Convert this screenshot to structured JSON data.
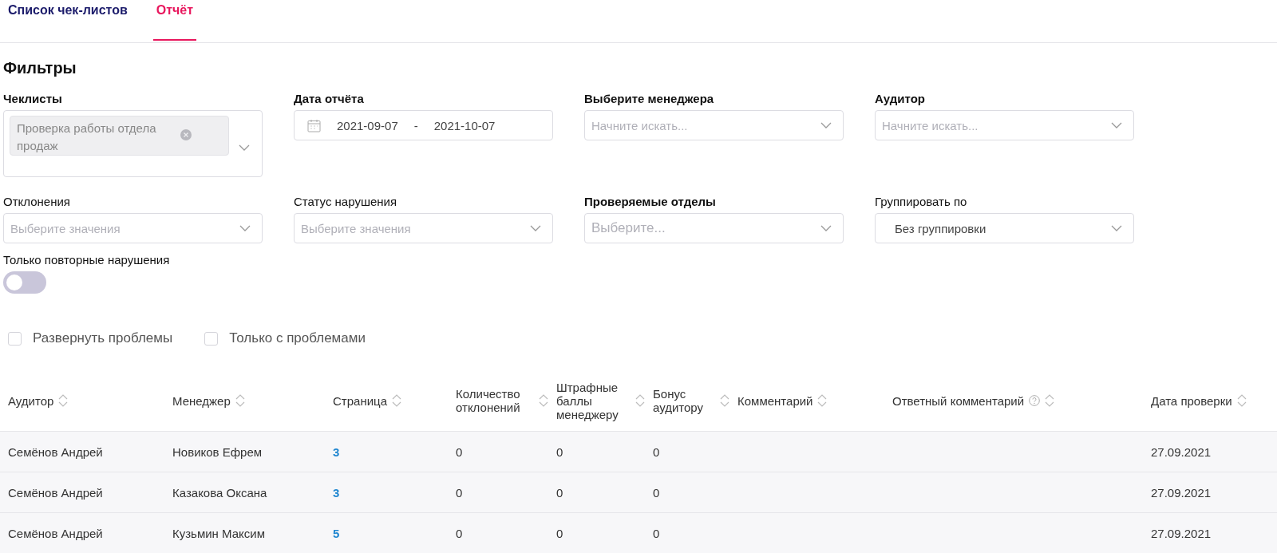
{
  "tabs": [
    {
      "label": "Список чек-листов",
      "selected": false
    },
    {
      "label": "Отчёт",
      "selected": true
    }
  ],
  "filters": {
    "title": "Фильтры",
    "fields": [
      {
        "kind": "tags",
        "label": "Чеклисты",
        "bold": true,
        "tags": [
          "Проверка работы отдела продаж"
        ]
      },
      {
        "kind": "daterange",
        "label": "Дата отчёта",
        "bold": true,
        "from": "2021-09-07",
        "separator": "-",
        "to": "2021-10-07"
      },
      {
        "kind": "select",
        "label": "Выберите менеджера",
        "bold": true,
        "placeholder": "Начните искать..."
      },
      {
        "kind": "select",
        "label": "Аудитор",
        "bold": true,
        "placeholder": "Начните искать..."
      },
      {
        "kind": "select",
        "label": "Отклонения",
        "bold": false,
        "placeholder": "Выберите значения"
      },
      {
        "kind": "select",
        "label": "Статус нарушения",
        "bold": false,
        "placeholder": "Выберите значения"
      },
      {
        "kind": "select",
        "label": "Проверяемые отделы",
        "bold": true,
        "placeholder": "Выберите..."
      },
      {
        "kind": "select",
        "label": "Группировать по",
        "bold": false,
        "value": "Без группировки"
      }
    ],
    "toggle": {
      "label": "Только повторные нарушения",
      "on": false
    }
  },
  "options": [
    {
      "label": "Развернуть проблемы",
      "checked": false
    },
    {
      "label": "Только с проблемами",
      "checked": false
    }
  ],
  "table": {
    "columns": [
      {
        "label": "Аудитор",
        "help": false,
        "link": false
      },
      {
        "label": "Менеджер",
        "help": false,
        "link": false
      },
      {
        "label": "Страница",
        "help": false,
        "link": true
      },
      {
        "label": "Количество отклонений",
        "help": false,
        "link": false
      },
      {
        "label": "Штрафные баллы менеджеру",
        "help": false,
        "link": false
      },
      {
        "label": "Бонус аудитору",
        "help": false,
        "link": false
      },
      {
        "label": "Комментарий",
        "help": false
      },
      {
        "label": "Ответный комментарий",
        "help": true
      },
      {
        "label": "Дата проверки",
        "help": false,
        "link": false
      }
    ],
    "rows": [
      [
        "Семёнов Андрей",
        "Новиков Ефрем",
        "3",
        "0",
        "0",
        "0",
        null,
        null,
        "27.09.2021"
      ],
      [
        "Семёнов Андрей",
        "Казакова Оксана",
        "3",
        "0",
        "0",
        "0",
        null,
        null,
        "27.09.2021"
      ],
      [
        "Семёнов Андрей",
        "Кузьмин Максим",
        "5",
        "0",
        "0",
        "0",
        null,
        null,
        "27.09.2021"
      ]
    ]
  }
}
